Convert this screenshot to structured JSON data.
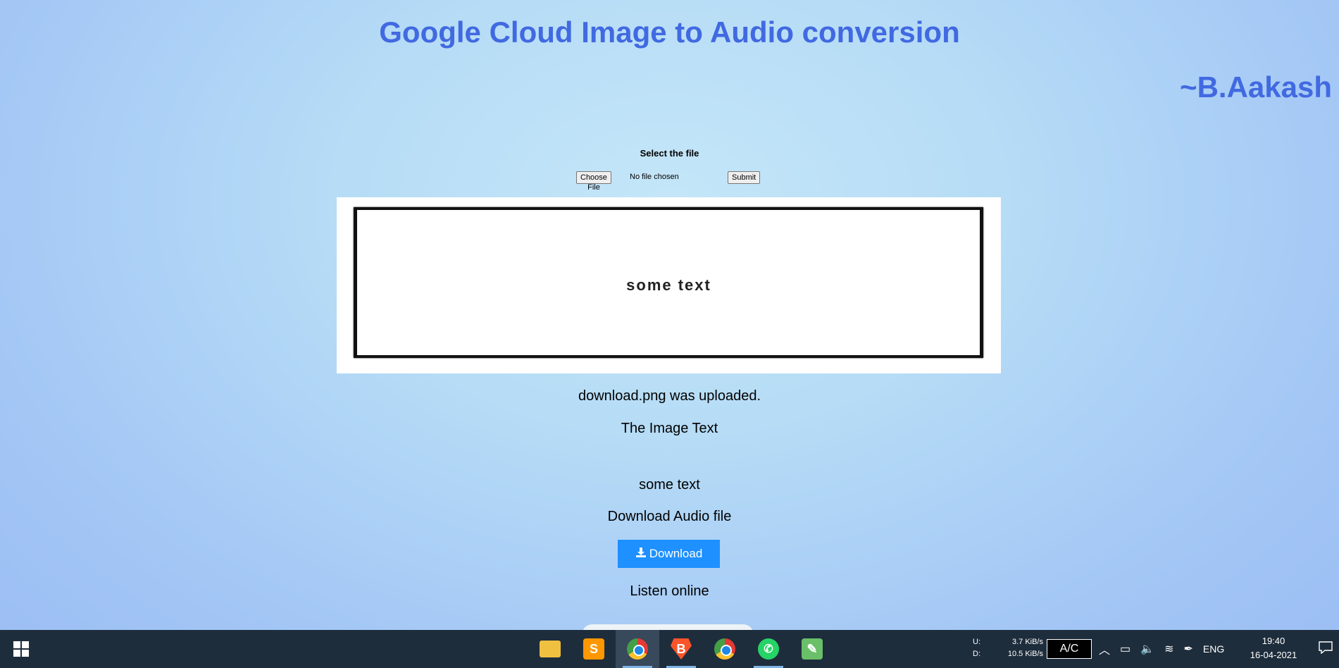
{
  "header": {
    "title": "Google Cloud Image to Audio conversion",
    "author": "~B.Aakash"
  },
  "upload_form": {
    "label": "Select the file",
    "choose_button": "Choose File",
    "file_status": "No file chosen",
    "submit_button": "Submit"
  },
  "preview": {
    "image_text": "some text"
  },
  "result": {
    "uploaded_message": "download.png was uploaded.",
    "image_text_heading": "The Image Text",
    "image_text": "some text",
    "download_heading": "Download Audio file",
    "download_button": "Download",
    "download_icon": "download-icon",
    "listen_heading": "Listen online"
  },
  "taskbar": {
    "apps": [
      {
        "name": "file-explorer-icon"
      },
      {
        "name": "sublime-text-icon",
        "glyph": "S"
      },
      {
        "name": "chrome-icon",
        "active": true
      },
      {
        "name": "brave-icon",
        "glyph": "B"
      },
      {
        "name": "chrome-profile-icon"
      },
      {
        "name": "whatsapp-icon",
        "glyph": "✆"
      },
      {
        "name": "image-editor-icon",
        "glyph": "✎"
      }
    ],
    "network": {
      "up_label": "U:",
      "up_value": "3.7 KiB/s",
      "down_label": "D:",
      "down_value": "10.5 KiB/s"
    },
    "ac_label": "A/C",
    "language": "ENG",
    "time": "19:40",
    "date": "16-04-2021"
  },
  "colors": {
    "title": "#4169e1",
    "download_button": "#1e90ff",
    "taskbar": "#1e2d3c"
  }
}
